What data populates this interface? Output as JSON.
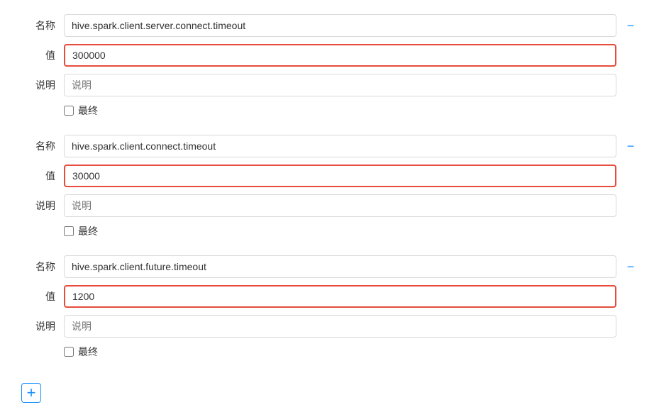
{
  "configs": [
    {
      "id": "config-1",
      "name_label": "名称",
      "name_value": "hive.spark.client.server.connect.timeout",
      "value_label": "值",
      "value_value": "300000",
      "desc_label": "说明",
      "desc_value": "",
      "desc_placeholder": "说明",
      "final_label": "最终",
      "highlighted": true
    },
    {
      "id": "config-2",
      "name_label": "名称",
      "name_value": "hive.spark.client.connect.timeout",
      "value_label": "值",
      "value_value": "30000",
      "desc_label": "说明",
      "desc_value": "",
      "desc_placeholder": "说明",
      "final_label": "最终",
      "highlighted": true
    },
    {
      "id": "config-3",
      "name_label": "名称",
      "name_value": "hive.spark.client.future.timeout",
      "value_label": "值",
      "value_value": "1200",
      "desc_label": "说明",
      "desc_value": "",
      "desc_placeholder": "说明",
      "final_label": "最终",
      "highlighted": true
    }
  ],
  "add_button_label": "⊕",
  "minus_icon": "−"
}
